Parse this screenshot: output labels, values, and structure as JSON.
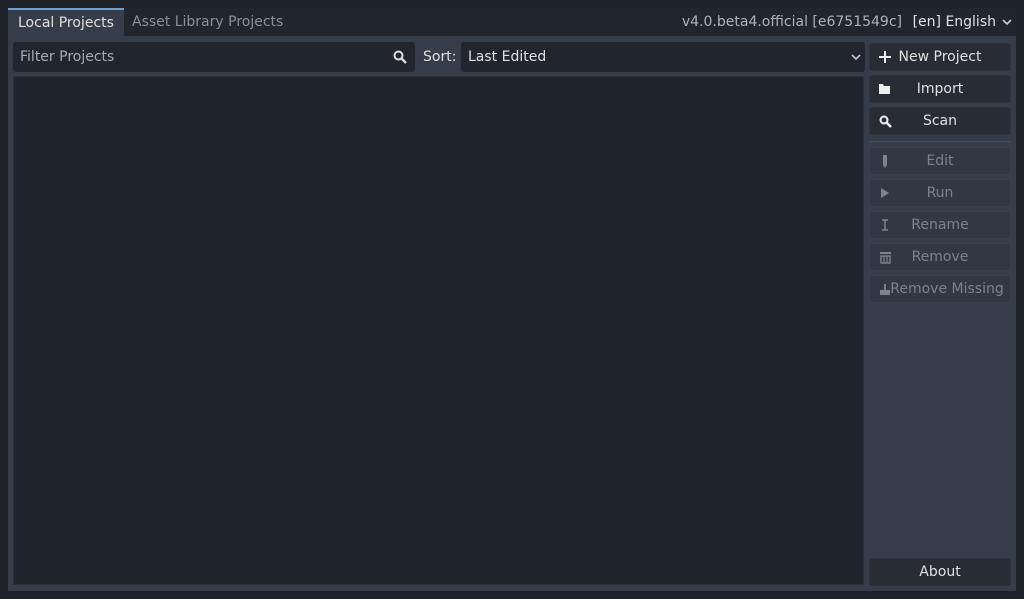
{
  "tabs": [
    {
      "label": "Local Projects",
      "active": true
    },
    {
      "label": "Asset Library Projects",
      "active": false
    }
  ],
  "version": "v4.0.beta4.official [e6751549c]",
  "language": "[en] English",
  "filter": {
    "placeholder": "Filter Projects",
    "value": ""
  },
  "sort": {
    "label": "Sort:",
    "value": "Last Edited"
  },
  "buttons": {
    "new_project": "New Project",
    "import": "Import",
    "scan": "Scan",
    "edit": "Edit",
    "run": "Run",
    "rename": "Rename",
    "remove": "Remove",
    "remove_missing": "Remove Missing",
    "about": "About"
  },
  "colors": {
    "accent": "#70a0d0",
    "panel": "#363d4a",
    "background": "#1d2128"
  }
}
